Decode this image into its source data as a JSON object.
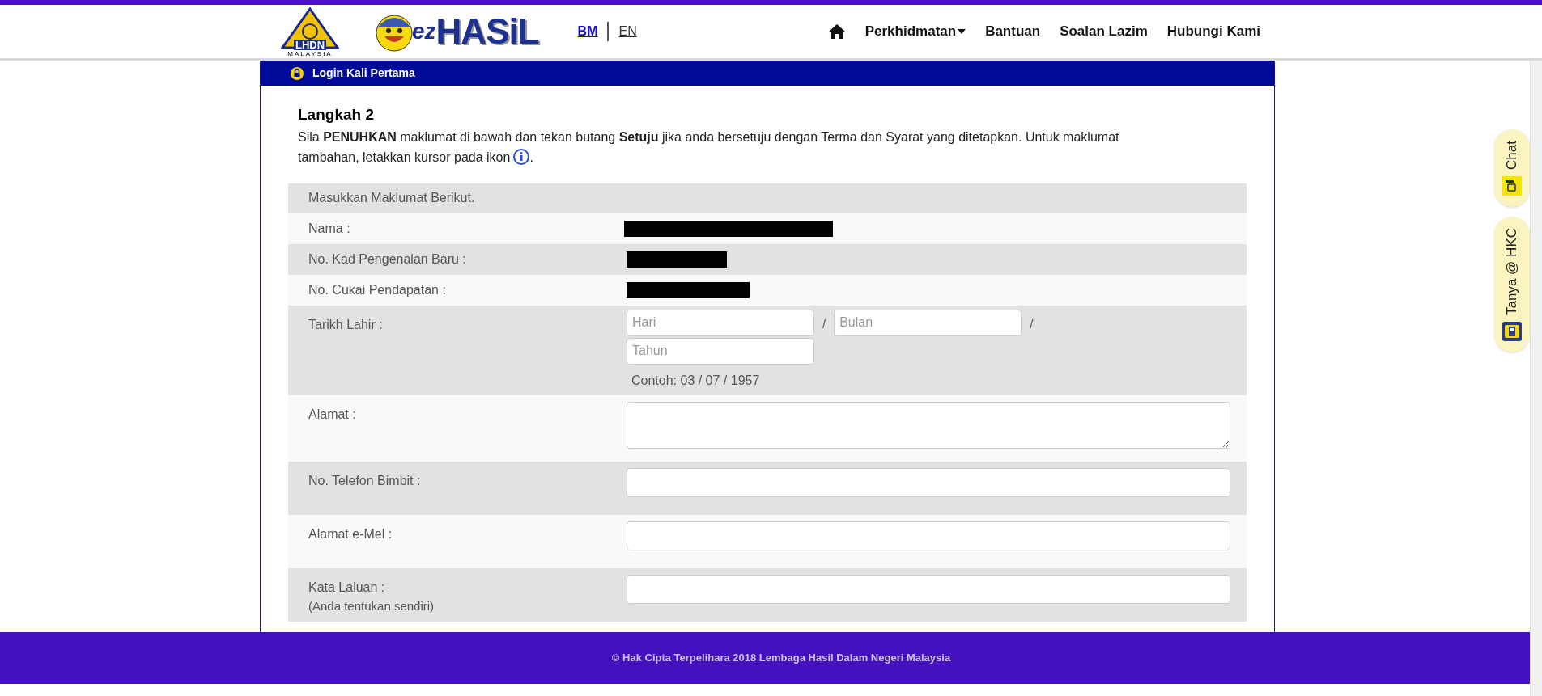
{
  "header": {
    "logo_lhdn": {
      "text": "LHDN",
      "subtext": "MALAYSIA"
    },
    "logo_ezhasil": {
      "prefix": "ez",
      "text": "HASiL"
    },
    "languages": [
      {
        "label": "BM",
        "selected": true
      },
      {
        "label": "EN",
        "selected": false
      }
    ],
    "nav": [
      {
        "label": "Perkhidmatan",
        "dropdown": true
      },
      {
        "label": "Bantuan",
        "dropdown": false
      },
      {
        "label": "Soalan Lazim",
        "dropdown": false
      },
      {
        "label": "Hubungi Kami",
        "dropdown": false
      }
    ]
  },
  "panel_title": "Login Kali Pertama",
  "step_title": "Langkah 2",
  "instructions": "Sila **PENUHKAN** maklumat di bawah dan tekan butang **Setuju** jika anda bersetuju dengan Terma dan Syarat yang ditetapkan. Untuk maklumat",
  "instructions_cont": "tambahan, letakkan kursor pada ikon",
  "instructions_end": ".",
  "form_heading": "Masukkan Maklumat Berikut.",
  "rows": [
    {
      "kind": "redacted",
      "label": "Nama :"
    },
    {
      "kind": "redacted",
      "label": "No. Kad Pengenalan Baru :"
    },
    {
      "kind": "redacted",
      "label": "No. Cukai Pendapatan :"
    },
    {
      "kind": "date",
      "label": "Tarikh Lahir :",
      "fields": [
        {
          "placeholder": "Hari"
        },
        {
          "placeholder": "Bulan"
        },
        {
          "placeholder": "Tahun"
        }
      ],
      "separators": [
        "/",
        "/"
      ],
      "hint": "Contoh: 03 / 07 / 1957"
    },
    {
      "kind": "textarea",
      "label": "Alamat :"
    },
    {
      "kind": "input",
      "label": "No. Telefon Bimbit :"
    },
    {
      "kind": "input",
      "label": "Alamat e-Mel :"
    },
    {
      "kind": "input",
      "label": "Kata Laluan :",
      "sublabel": "(Anda tentukan sendiri)"
    }
  ],
  "footer": "© Hak Cipta Terpelihara 2018 Lembaga Hasil Dalam Negeri Malaysia",
  "side_tabs": [
    {
      "label": "Chat",
      "kind": "chat"
    },
    {
      "label": "Tanya @ HKC",
      "kind": "hkc"
    }
  ]
}
